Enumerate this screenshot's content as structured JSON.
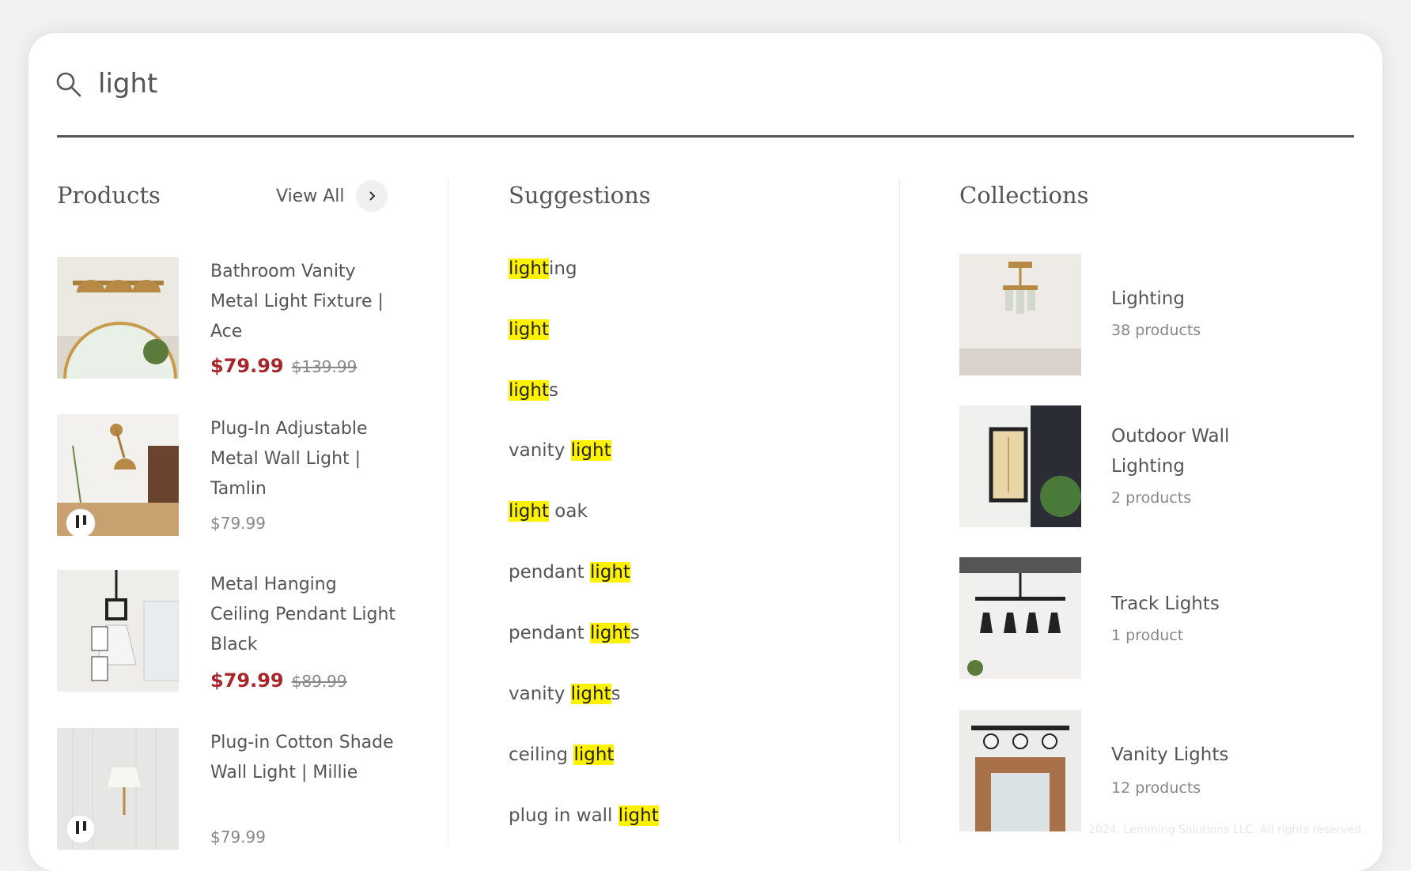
{
  "search": {
    "value": "light"
  },
  "products": {
    "title": "Products",
    "view_all": "View All",
    "items": [
      {
        "name": "Bathroom Vanity Metal Light Fixture | Ace",
        "sale_price": "$79.99",
        "old_price": "$139.99"
      },
      {
        "name": "Plug-In Adjustable Metal Wall Light | Tamlin",
        "price": "$79.99"
      },
      {
        "name": "Metal Hanging Ceiling Pendant Light Black",
        "sale_price": "$79.99",
        "old_price": "$89.99"
      },
      {
        "name": "Plug-in Cotton Shade Wall Light | Millie",
        "price": "$79.99"
      }
    ]
  },
  "suggestions": {
    "title": "Suggestions",
    "items": [
      {
        "pre": "",
        "match": "light",
        "post": "ing"
      },
      {
        "pre": "",
        "match": "light",
        "post": ""
      },
      {
        "pre": "",
        "match": "light",
        "post": "s"
      },
      {
        "pre": "vanity ",
        "match": "light",
        "post": ""
      },
      {
        "pre": "",
        "match": "light",
        "post": " oak"
      },
      {
        "pre": "pendant ",
        "match": "light",
        "post": ""
      },
      {
        "pre": "pendant ",
        "match": "light",
        "post": "s"
      },
      {
        "pre": "vanity ",
        "match": "light",
        "post": "s"
      },
      {
        "pre": "ceiling ",
        "match": "light",
        "post": ""
      },
      {
        "pre": "plug in wall ",
        "match": "light",
        "post": ""
      }
    ]
  },
  "collections": {
    "title": "Collections",
    "items": [
      {
        "title": "Lighting",
        "count": "38 products"
      },
      {
        "title": "Outdoor Wall Lighting",
        "count": "2 products"
      },
      {
        "title": "Track Lights",
        "count": "1 product"
      },
      {
        "title": "Vanity Lights",
        "count": "12 products"
      }
    ]
  },
  "footer": {
    "copyright": "2024, Lemming Solutions LLC. All rights reserved."
  },
  "colors": {
    "sale": "#a8262a",
    "highlight": "#fff200",
    "divider": "#555555"
  }
}
